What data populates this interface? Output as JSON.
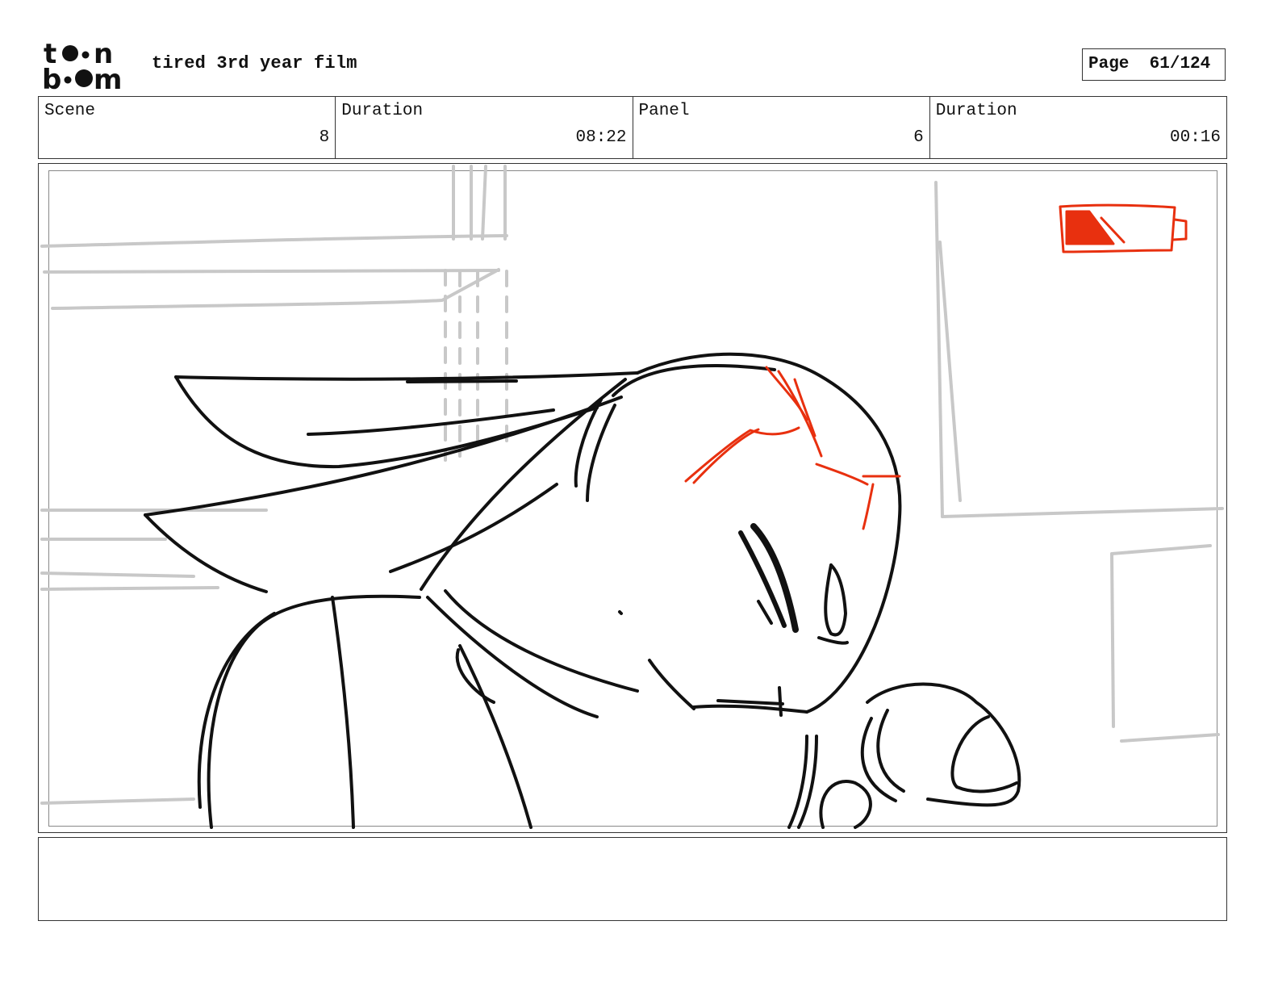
{
  "header": {
    "logo_text": "toon boom",
    "project_title": "tired 3rd year film",
    "page_label": "Page",
    "page_number": "61/124"
  },
  "info": {
    "scene_label": "Scene",
    "scene_value": "8",
    "scene_duration_label": "Duration",
    "scene_duration_value": "08:22",
    "panel_label": "Panel",
    "panel_value": "6",
    "panel_duration_label": "Duration",
    "panel_duration_value": "00:16"
  },
  "notes": {
    "text": ""
  },
  "colors": {
    "ink": "#111111",
    "background_lines": "#c8c8c8",
    "accent_red": "#e8300f"
  },
  "icons": {
    "battery": "battery-low-icon"
  }
}
